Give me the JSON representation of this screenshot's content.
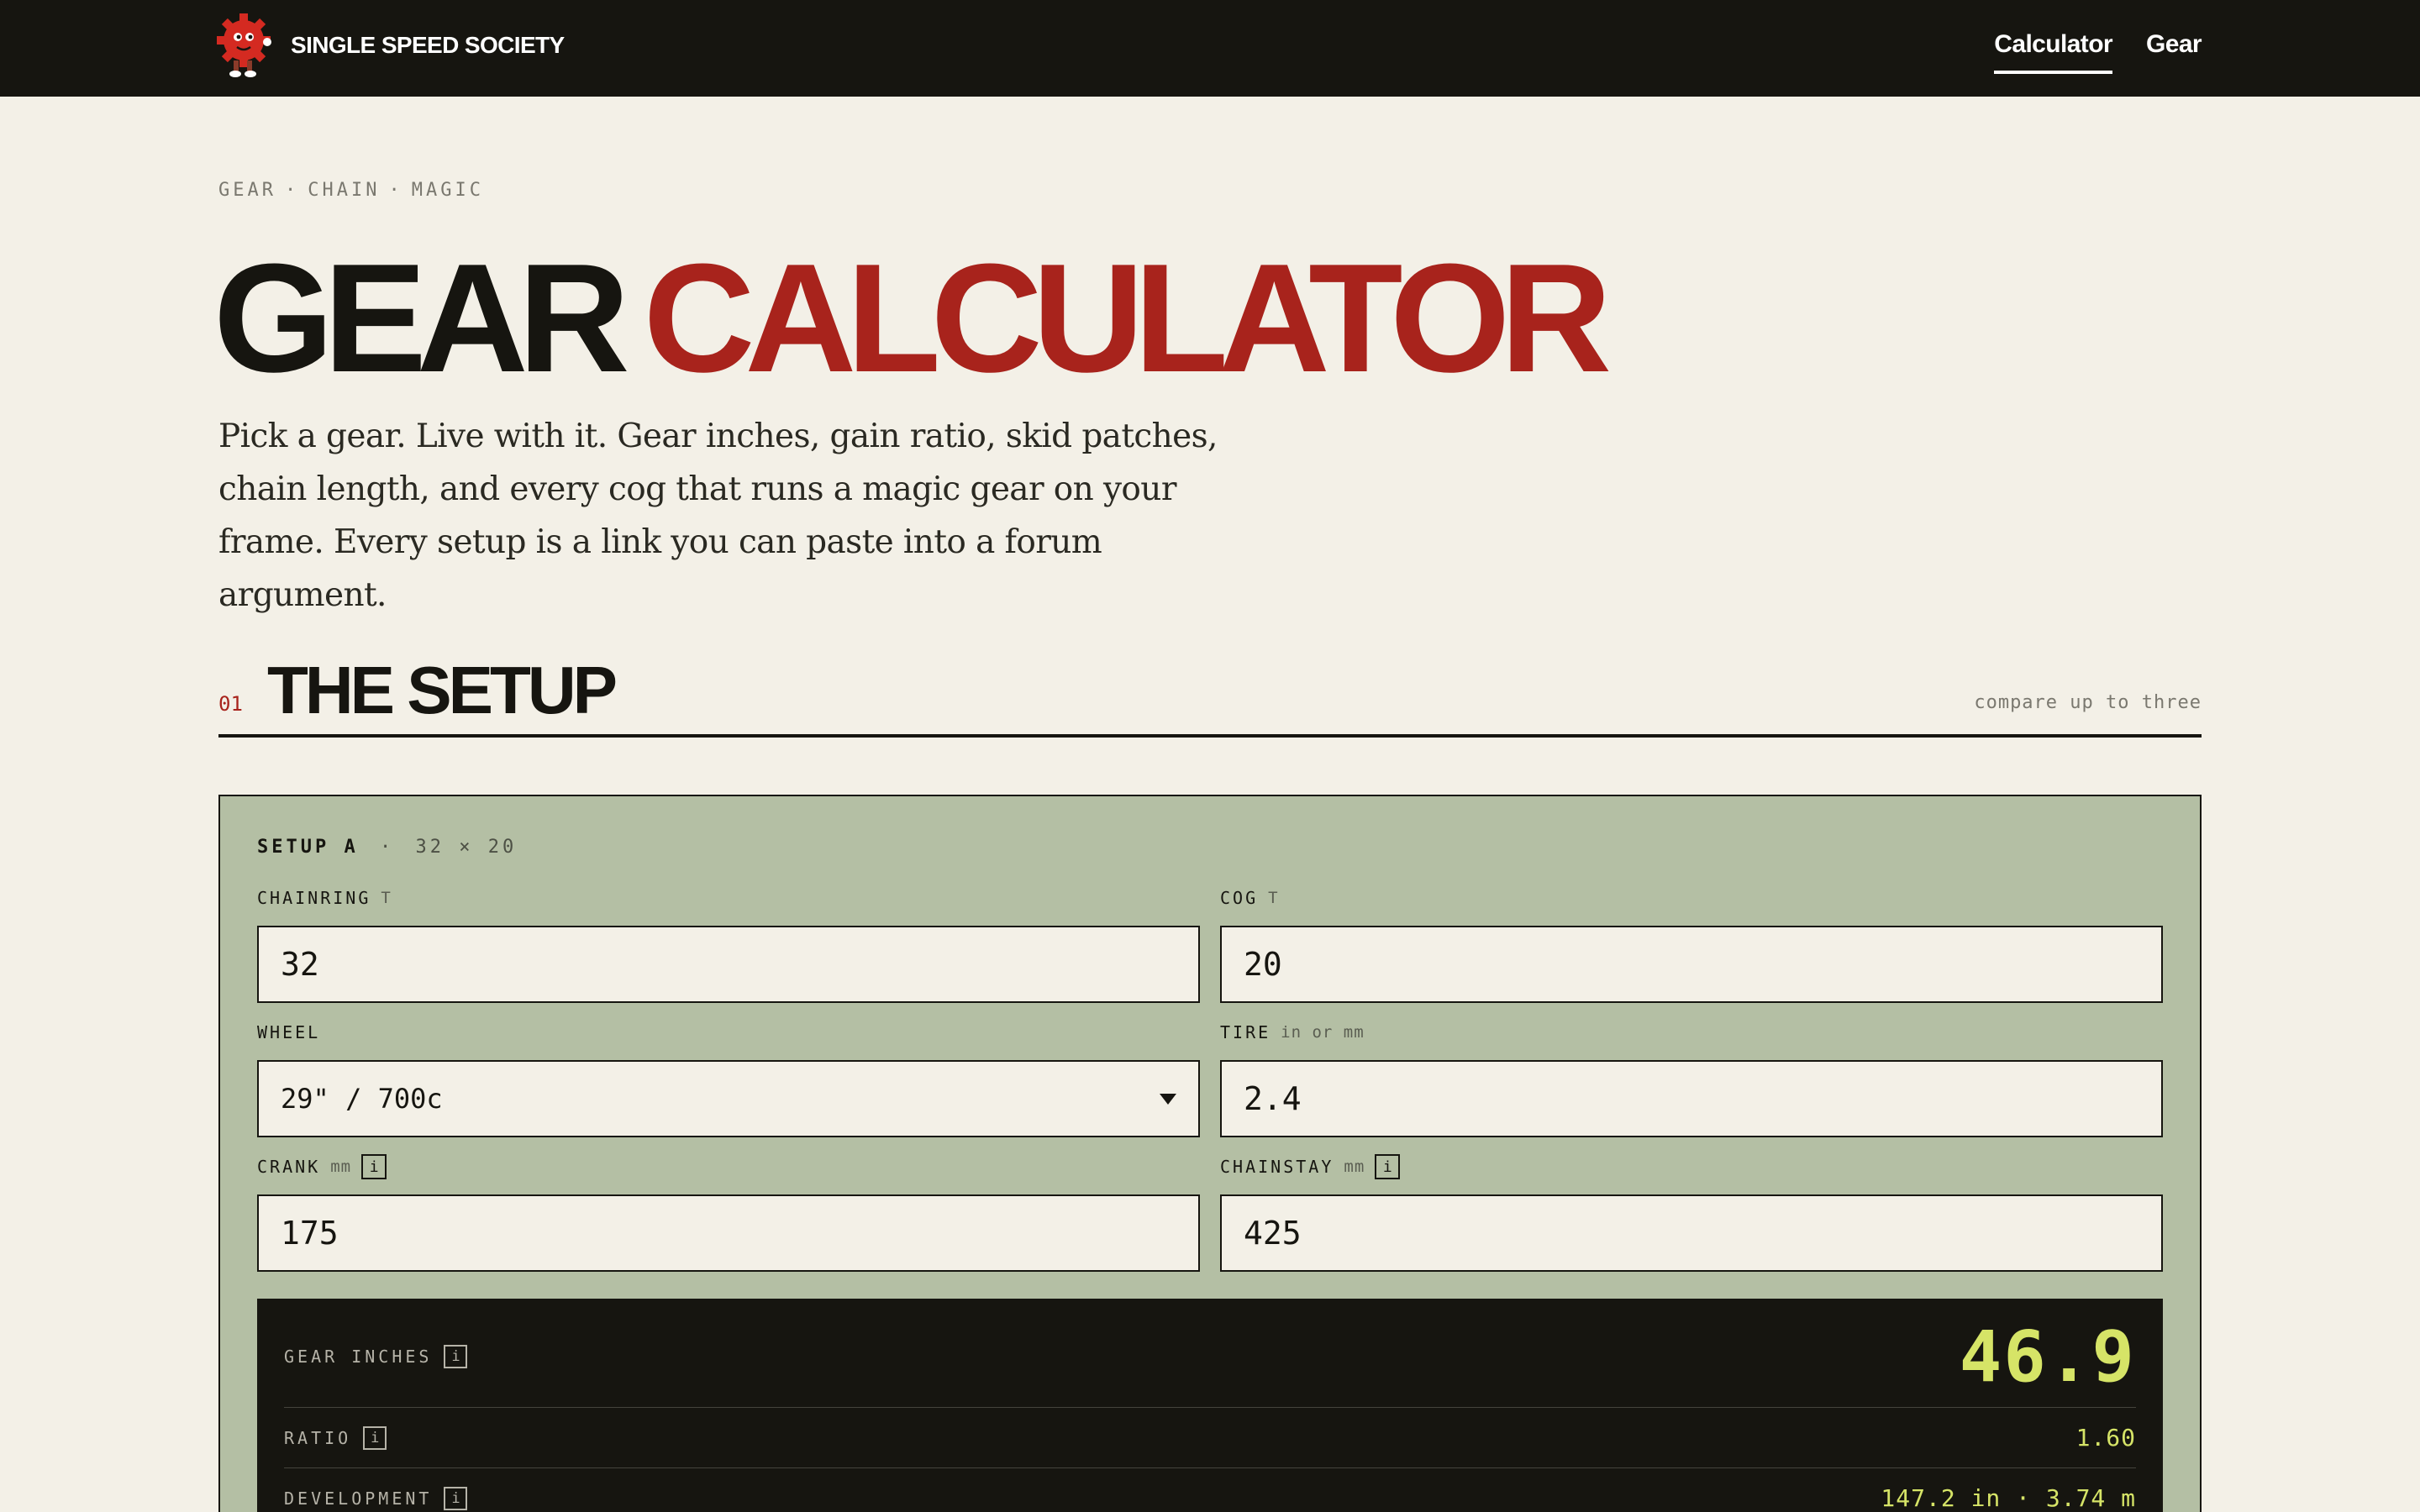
{
  "nav": {
    "brand": "SINGLE SPEED SOCIETY",
    "links": [
      {
        "label": "Calculator",
        "active": true
      },
      {
        "label": "Gear",
        "active": false
      }
    ]
  },
  "hero": {
    "eyebrow": [
      "GEAR",
      "CHAIN",
      "MAGIC"
    ],
    "eyebrow_separator": "·",
    "title_part1": "GEAR",
    "title_part2": "CALCULATOR",
    "lede": "Pick a gear. Live with it. Gear inches, gain ratio, skid patches, chain length, and every cog that runs a magic gear on your frame. Every setup is a link you can paste into a forum argument."
  },
  "section": {
    "number": "01",
    "title": "THE SETUP",
    "note": "compare up to three"
  },
  "setup": {
    "name": "SETUP A",
    "separator": "·",
    "combo": "32 × 20",
    "info_glyph": "i",
    "fields": {
      "chainring": {
        "label": "CHAINRING",
        "unit": "T",
        "value": "32"
      },
      "cog": {
        "label": "COG",
        "unit": "T",
        "value": "20"
      },
      "wheel": {
        "label": "WHEEL",
        "value": "29\" / 700c"
      },
      "tire": {
        "label": "TIRE",
        "unit": "in or mm",
        "value": "2.4"
      },
      "crank": {
        "label": "CRANK",
        "unit": "mm",
        "value": "175"
      },
      "chainstay": {
        "label": "CHAINSTAY",
        "unit": "mm",
        "value": "425"
      }
    },
    "results": {
      "gear_inches": {
        "label": "GEAR INCHES",
        "value": "46.9"
      },
      "ratio": {
        "label": "RATIO",
        "value": "1.60"
      },
      "development": {
        "label": "DEVELOPMENT",
        "value": "147.2 in · 3.74 m"
      }
    }
  },
  "colors": {
    "ink": "#161510",
    "paper": "#f3f0e7",
    "accent_red": "#a8231c",
    "sage": "#b4bfa4",
    "lime": "#d6e467"
  },
  "icons": {
    "logo": "red-cog-mascot-icon",
    "wheel_select": "caret-down-icon",
    "info": "info-icon"
  }
}
